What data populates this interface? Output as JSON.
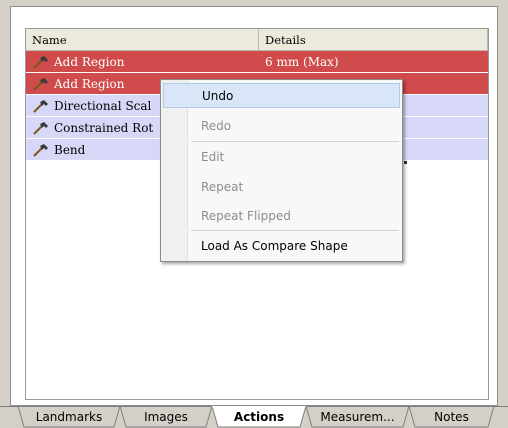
{
  "table": {
    "columns": [
      "Name",
      "Details"
    ],
    "rows": [
      {
        "name": "Add Region",
        "details": "6 mm (Max)",
        "selected": true
      },
      {
        "name": "Add Region",
        "details": "",
        "selected": true
      },
      {
        "name": "Directional Scal",
        "details": "",
        "selected": false
      },
      {
        "name": "Constrained Rot",
        "details": "",
        "selected": false
      },
      {
        "name": "Bend",
        "details": "",
        "selected": false
      }
    ]
  },
  "context_menu": {
    "items": [
      {
        "label": "Undo",
        "enabled": true,
        "highlighted": true
      },
      {
        "label": "Redo",
        "enabled": false
      },
      {
        "label": "Edit",
        "enabled": false
      },
      {
        "label": "Repeat",
        "enabled": false
      },
      {
        "label": "Repeat Flipped",
        "enabled": false
      },
      {
        "label": "Load As Compare Shape",
        "enabled": true
      }
    ]
  },
  "tabs": [
    {
      "label": "Landmarks",
      "active": false
    },
    {
      "label": "Images",
      "active": false
    },
    {
      "label": "Actions",
      "active": true
    },
    {
      "label": "Measurem...",
      "active": false
    },
    {
      "label": "Notes",
      "active": false
    }
  ],
  "colors": {
    "selected_row": "#d04b4b",
    "normal_row": "#d7d8f8",
    "menu_highlight": "#d8e6f7",
    "icon": "#7a5a1a"
  },
  "icons": {
    "row_icon": "hammer-icon"
  }
}
